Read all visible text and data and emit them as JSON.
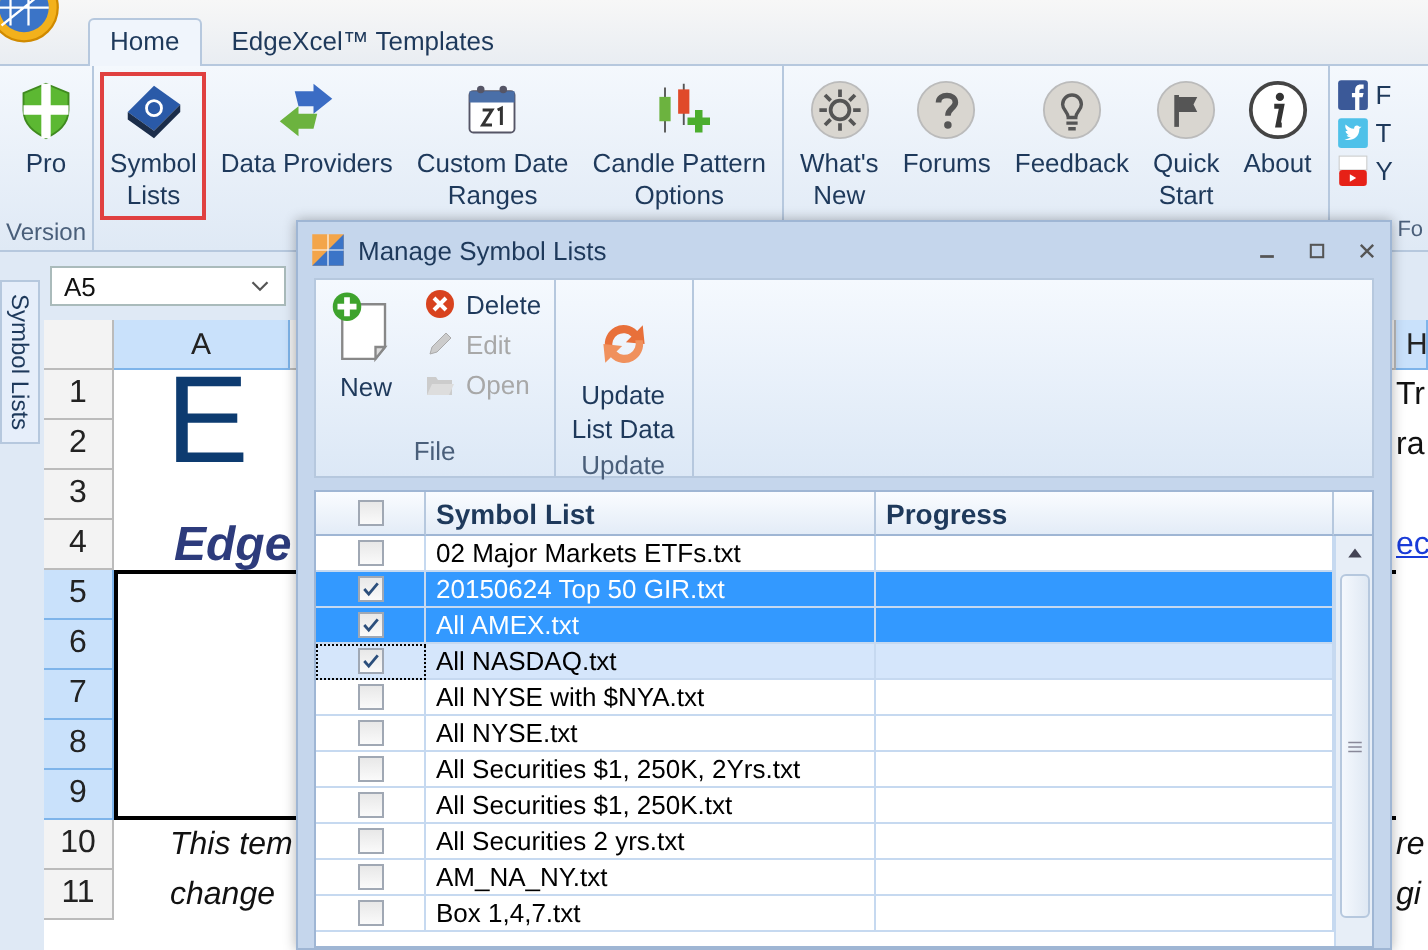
{
  "app_tabs": [
    {
      "label": "Home",
      "selected": true
    },
    {
      "label": "EdgeXcel™ Templates",
      "selected": false
    }
  ],
  "ribbon": {
    "groups": [
      {
        "label": "Version",
        "buttons": [
          {
            "kind": "shield",
            "lines": [
              "Pro"
            ],
            "highlighted": false
          }
        ]
      },
      {
        "buttons": [
          {
            "kind": "book",
            "lines": [
              "Symbol",
              "Lists"
            ],
            "highlighted": true
          },
          {
            "kind": "arrows",
            "lines": [
              "Data Providers"
            ],
            "highlighted": false
          },
          {
            "kind": "calendar",
            "lines": [
              "Custom Date",
              "Ranges"
            ],
            "highlighted": false
          },
          {
            "kind": "candles",
            "lines": [
              "Candle Pattern",
              "Options"
            ],
            "highlighted": false
          }
        ]
      },
      {
        "buttons": [
          {
            "kind": "sun",
            "lines": [
              "What's",
              "New"
            ],
            "highlighted": false
          },
          {
            "kind": "question",
            "lines": [
              "Forums"
            ],
            "highlighted": false
          },
          {
            "kind": "bulb",
            "lines": [
              "Feedback"
            ],
            "highlighted": false
          },
          {
            "kind": "flag",
            "lines": [
              "Quick",
              "Start"
            ],
            "highlighted": false
          },
          {
            "kind": "info",
            "lines": [
              "About"
            ],
            "highlighted": false
          }
        ]
      },
      {
        "label": "Fo",
        "social": [
          {
            "kind": "facebook",
            "label": "F"
          },
          {
            "kind": "twitter",
            "label": "T"
          },
          {
            "kind": "youtube",
            "label": "Y"
          }
        ]
      }
    ]
  },
  "side_tab": {
    "label": "Symbol Lists"
  },
  "sheet": {
    "name_box": "A5",
    "columns": [
      {
        "label": "A",
        "selected": true
      },
      {
        "label": "H",
        "selected": true
      }
    ],
    "rows": [
      {
        "label": "1",
        "selected": false
      },
      {
        "label": "2",
        "selected": false
      },
      {
        "label": "3",
        "selected": false
      },
      {
        "label": "4",
        "selected": false
      },
      {
        "label": "5",
        "selected": true
      },
      {
        "label": "6",
        "selected": true
      },
      {
        "label": "7",
        "selected": true
      },
      {
        "label": "8",
        "selected": true
      },
      {
        "label": "9",
        "selected": true
      },
      {
        "label": "10",
        "selected": false
      },
      {
        "label": "11",
        "selected": false
      }
    ],
    "logo_text": "E",
    "subtitle": "Edge",
    "body_lines": [
      "This tem",
      "change"
    ],
    "right_lines": [
      "Tr",
      "ra"
    ],
    "link": "ec",
    "right_body_lines": [
      "re",
      "gi"
    ]
  },
  "dialog": {
    "title": "Manage Symbol Lists",
    "groups": [
      {
        "label": "File",
        "large": {
          "kind": "new",
          "label": "New"
        },
        "small": [
          {
            "kind": "delete",
            "label": "Delete",
            "disabled": false
          },
          {
            "kind": "edit",
            "label": "Edit",
            "disabled": true
          },
          {
            "kind": "open",
            "label": "Open",
            "disabled": true
          }
        ]
      },
      {
        "label": "Update",
        "large": {
          "kind": "update",
          "label": "Update List Data"
        }
      }
    ],
    "columns": [
      "Symbol List",
      "Progress"
    ],
    "all_checked": false,
    "rows": [
      {
        "name": "02 Major Markets  ETFs.txt",
        "checked": false,
        "selected": false,
        "focused": false
      },
      {
        "name": "20150624 Top 50 GIR.txt",
        "checked": true,
        "selected": true,
        "focused": false
      },
      {
        "name": "All AMEX.txt",
        "checked": true,
        "selected": true,
        "focused": false
      },
      {
        "name": "All NASDAQ.txt",
        "checked": true,
        "selected": false,
        "focused": true
      },
      {
        "name": "All NYSE with $NYA.txt",
        "checked": false,
        "selected": false,
        "focused": false
      },
      {
        "name": "All NYSE.txt",
        "checked": false,
        "selected": false,
        "focused": false
      },
      {
        "name": "All Securities $1, 250K, 2Yrs.txt",
        "checked": false,
        "selected": false,
        "focused": false
      },
      {
        "name": "All Securities $1, 250K.txt",
        "checked": false,
        "selected": false,
        "focused": false
      },
      {
        "name": "All Securities 2 yrs.txt",
        "checked": false,
        "selected": false,
        "focused": false
      },
      {
        "name": "AM_NA_NY.txt",
        "checked": false,
        "selected": false,
        "focused": false
      },
      {
        "name": "Box 1,4,7.txt",
        "checked": false,
        "selected": false,
        "focused": false
      }
    ]
  }
}
